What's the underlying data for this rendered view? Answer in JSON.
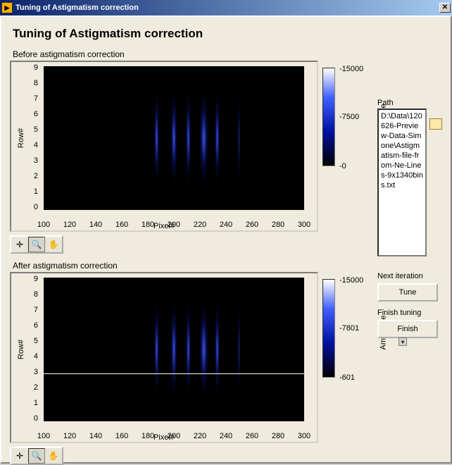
{
  "window": {
    "title": "Tuning of Astigmatism correction"
  },
  "dialog": {
    "heading": "Tuning of Astigmatism correction"
  },
  "before": {
    "label": "Before astigmatism correction",
    "xlabel": "Pixel#",
    "ylabel": "Row#",
    "xticks": [
      "100",
      "120",
      "140",
      "160",
      "180",
      "200",
      "220",
      "240",
      "260",
      "280",
      "300"
    ],
    "yticks": [
      "0",
      "1",
      "2",
      "3",
      "4",
      "5",
      "6",
      "7",
      "8",
      "9"
    ],
    "colorbar": {
      "label": "Amplitude",
      "ticks": [
        "0",
        "7500",
        "15000"
      ]
    }
  },
  "after": {
    "label": "After astigmatism correction",
    "xlabel": "Pixel#",
    "ylabel": "Row#",
    "xticks": [
      "100",
      "120",
      "140",
      "160",
      "180",
      "200",
      "220",
      "240",
      "260",
      "280",
      "300"
    ],
    "yticks": [
      "0",
      "1",
      "2",
      "3",
      "4",
      "5",
      "6",
      "7",
      "8",
      "9"
    ],
    "colorbar": {
      "label": "Amplitude",
      "ticks": [
        "601",
        "7801",
        "15000"
      ]
    }
  },
  "path": {
    "label": "Path",
    "value": "D:\\Data\\120626-Preview-Data-Simone\\Astigmatism-file-from-Ne-Lines-9x1340bins.txt"
  },
  "buttons": {
    "tune_section": "Next iteration",
    "tune": "Tune",
    "finish_section": "Finish tuning",
    "finish": "Finish"
  },
  "chart_data": [
    {
      "type": "heatmap",
      "title": "Before astigmatism correction",
      "xlabel": "Pixel#",
      "ylabel": "Row#",
      "xlim": [
        100,
        300
      ],
      "ylim": [
        0,
        9
      ],
      "colorscale": "Amplitude",
      "clim": [
        0,
        15000
      ],
      "spectral_peaks_x": [
        185,
        200,
        210,
        222,
        232,
        250
      ],
      "peak_widths": [
        6,
        8,
        6,
        8,
        6,
        4
      ],
      "peak_intensities": [
        4000,
        11000,
        6000,
        12000,
        6000,
        3000
      ]
    },
    {
      "type": "heatmap",
      "title": "After astigmatism correction",
      "xlabel": "Pixel#",
      "ylabel": "Row#",
      "xlim": [
        100,
        300
      ],
      "ylim": [
        0,
        9
      ],
      "colorscale": "Amplitude",
      "clim": [
        601,
        15000
      ],
      "spectral_peaks_x": [
        185,
        200,
        210,
        222,
        232,
        250
      ],
      "peak_widths": [
        5,
        7,
        5,
        7,
        5,
        3
      ],
      "peak_intensities": [
        4000,
        12000,
        6000,
        13000,
        6000,
        3000
      ],
      "cursor_row": 3
    }
  ]
}
